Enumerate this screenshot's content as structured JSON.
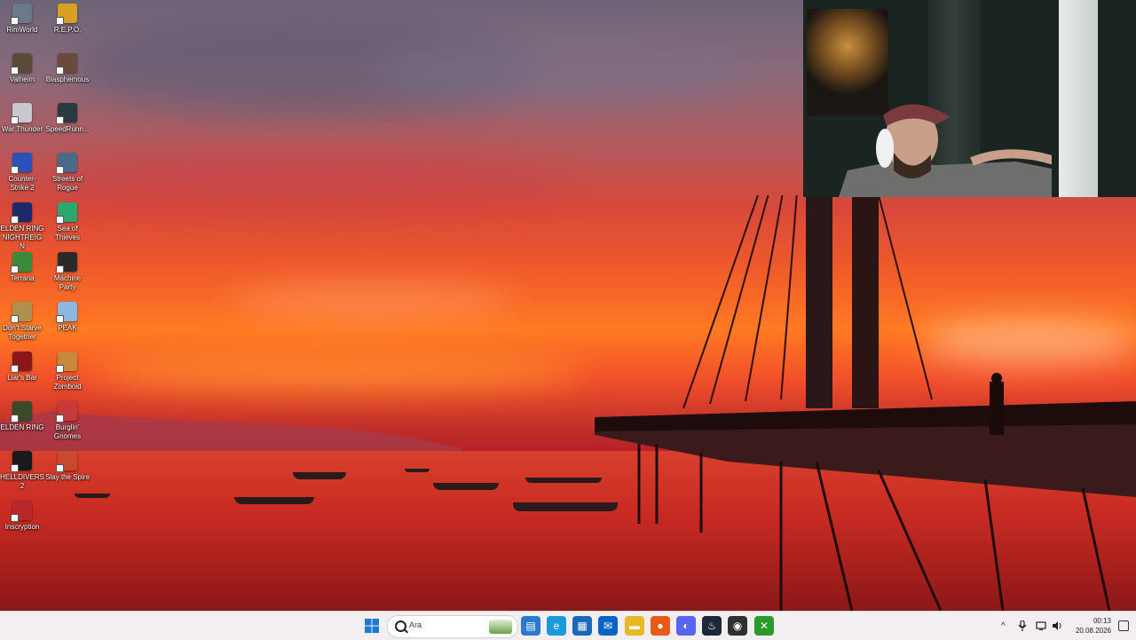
{
  "desktop": {
    "icons": [
      {
        "label": "RimWorld",
        "color": "#6a7a8a"
      },
      {
        "label": "R.E.P.O.",
        "color": "#d8a020"
      },
      {
        "label": "Valheim",
        "color": "#5a4a38"
      },
      {
        "label": "Blasphemous",
        "color": "#6a4a3a"
      },
      {
        "label": "War Thunder",
        "color": "#c8c8d0"
      },
      {
        "label": "SpeedRunn...",
        "color": "#2a3a40"
      },
      {
        "label": "Counter-Strike 2",
        "color": "#2a52b8"
      },
      {
        "label": "Streets of Rogue",
        "color": "#4a6a8a"
      },
      {
        "label": "ELDEN RING NIGHTREIGN",
        "color": "#1a2a6a"
      },
      {
        "label": "Sea of Thieves",
        "color": "#2aa870"
      },
      {
        "label": "Terraria",
        "color": "#3a8a3a"
      },
      {
        "label": "Machine Party",
        "color": "#2a2a2a"
      },
      {
        "label": "Don't Starve Together",
        "color": "#b09050"
      },
      {
        "label": "PEAK",
        "color": "#8ab8e0"
      },
      {
        "label": "Liar's Bar",
        "color": "#8a1818"
      },
      {
        "label": "Project Zomboid",
        "color": "#c88a3a"
      },
      {
        "label": "ELDEN RING",
        "color": "#3a4a2a"
      },
      {
        "label": "Burglin' Gnomes",
        "color": "#c83a3a"
      },
      {
        "label": "HELLDIVERS 2",
        "color": "#1a1a1a"
      },
      {
        "label": "Slay the Spire",
        "color": "#c84a2a"
      },
      {
        "label": "Inscryption",
        "color": "#b8282a"
      }
    ]
  },
  "taskbar": {
    "search_placeholder": "Ara",
    "apps": [
      {
        "name": "start-button",
        "color": "#1a78d8",
        "glyph": "⊞"
      },
      {
        "name": "news-widget-app",
        "color": "#2a7ad0",
        "glyph": "▤"
      },
      {
        "name": "edge-browser-app",
        "color": "#1a9ad8",
        "glyph": "e"
      },
      {
        "name": "microsoft-store-app",
        "color": "#1a6ab8",
        "glyph": "▦"
      },
      {
        "name": "outlook-app",
        "color": "#0a64c8",
        "glyph": "✉"
      },
      {
        "name": "file-explorer-app",
        "color": "#e8b828",
        "glyph": "▬"
      },
      {
        "name": "firefox-app",
        "color": "#e85a18",
        "glyph": "●"
      },
      {
        "name": "discord-app",
        "color": "#5865f2",
        "glyph": "◐"
      },
      {
        "name": "steam-app",
        "color": "#1b2838",
        "glyph": "♨"
      },
      {
        "name": "obs-app",
        "color": "#303030",
        "glyph": "◉"
      },
      {
        "name": "xbox-app",
        "color": "#2a9a2a",
        "glyph": "✕"
      }
    ],
    "tray": {
      "chevron": "^",
      "clock_time": "00:13",
      "clock_date": "20.08.2026"
    }
  }
}
